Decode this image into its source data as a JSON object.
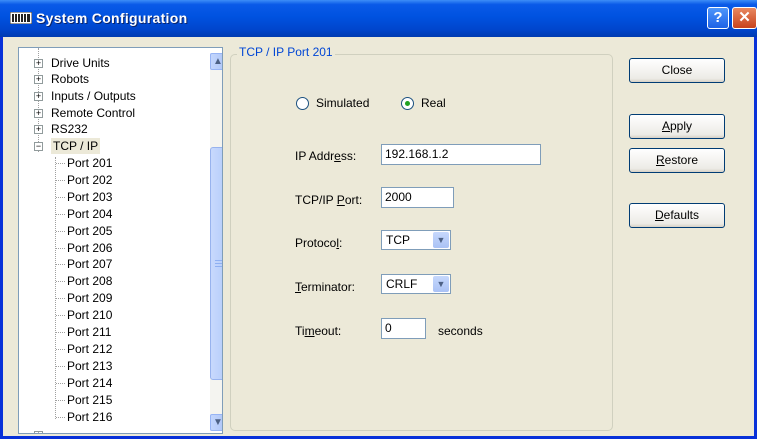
{
  "window": {
    "title": "System Configuration",
    "help_glyph": "?",
    "close_glyph": "✕"
  },
  "tree": {
    "root_items": [
      {
        "label": "Drive Units"
      },
      {
        "label": "Robots"
      },
      {
        "label": "Inputs / Outputs"
      },
      {
        "label": "Remote Control"
      },
      {
        "label": "RS232"
      },
      {
        "label": "TCP / IP"
      }
    ],
    "children": [
      "Port 201",
      "Port 202",
      "Port 203",
      "Port 204",
      "Port 205",
      "Port 206",
      "Port 207",
      "Port 208",
      "Port 209",
      "Port 210",
      "Port 211",
      "Port 212",
      "Port 213",
      "Port 214",
      "Port 215",
      "Port 216"
    ],
    "selected": "TCP / IP",
    "expand_collapsed": "+",
    "expand_open": "−"
  },
  "scrollbar": {
    "up_glyph": "▲",
    "down_glyph": "▼"
  },
  "panel": {
    "title": "TCP / IP Port 201",
    "mode": {
      "options": [
        "Simulated",
        "Real"
      ],
      "selected": "Real"
    },
    "ip_address": {
      "label_pre": "IP Addr",
      "label_u": "e",
      "label_post": "ss:",
      "value": "192.168.1.2"
    },
    "tcp_port": {
      "label_pre": "TCP/IP ",
      "label_u": "P",
      "label_post": "ort:",
      "value": "2000"
    },
    "protocol": {
      "label_pre": "Protoco",
      "label_u": "l",
      "label_post": ":",
      "value": "TCP"
    },
    "terminator": {
      "label_pre": "",
      "label_u": "T",
      "label_post": "erminator:",
      "value": "CRLF"
    },
    "timeout": {
      "label_pre": "Ti",
      "label_u": "m",
      "label_post": "eout:",
      "value": "0",
      "unit": "seconds"
    },
    "dropdown_glyph": "▼"
  },
  "buttons": {
    "close": {
      "label": "Close"
    },
    "apply": {
      "label_u": "A",
      "label_rest": "pply"
    },
    "restore": {
      "label_u": "R",
      "label_rest": "estore"
    },
    "defaults": {
      "label_u": "D",
      "label_rest": "efaults"
    }
  },
  "colors": {
    "title_bar": "#0052e0",
    "frame": "#0831d9",
    "legend_text": "#0046d5",
    "radio_dot": "#21a121",
    "window_bg": "#ece9d8"
  }
}
